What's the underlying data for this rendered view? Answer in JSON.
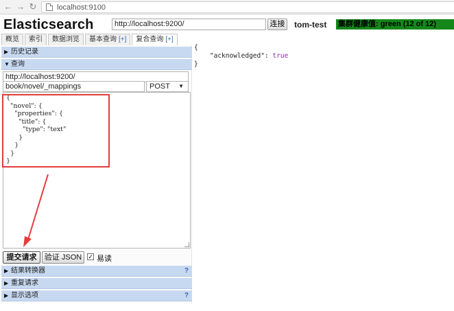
{
  "browser": {
    "url": "localhost:9100"
  },
  "header": {
    "title": "Elasticsearch",
    "connection_url": "http://localhost:9200/",
    "connect_label": "连接",
    "cluster_name": "tom-test",
    "health_text": "集群健康值: green (12 of 12)",
    "health_color": "#14871a"
  },
  "tabs": [
    {
      "label": "概览",
      "plus": ""
    },
    {
      "label": "索引",
      "plus": ""
    },
    {
      "label": "数据浏览",
      "plus": ""
    },
    {
      "label": "基本查询",
      "plus": "[+]"
    },
    {
      "label": "复合查询",
      "plus": "[+]",
      "active": true
    }
  ],
  "left_panel": {
    "history_label": "历史记录",
    "query_label": "查询",
    "server_url": "http://localhost:9200/",
    "path": "book/novel/_mappings",
    "method": "POST",
    "request_body_lines": [
      "{",
      "  \"novel\": {",
      "    \"properties\": {",
      "      \"title\": {",
      "        \"type\": \"text\"",
      "      }",
      "    }",
      "  }",
      "}"
    ],
    "submit_label": "提交请求",
    "validate_label": "验证 JSON",
    "pretty_label": "易读",
    "pretty_checked": true,
    "sections": [
      {
        "label": "结果转换器",
        "help": "?"
      },
      {
        "label": "重复请求",
        "help": ""
      },
      {
        "label": "显示选项",
        "help": "?"
      }
    ]
  },
  "result": {
    "open_brace": "{",
    "key": "\"acknowledged\"",
    "separator": ": ",
    "value": "true",
    "close_brace": "}"
  },
  "colors": {
    "section_bar": "#c7d9f1",
    "highlight": "#e53b3b",
    "bool_value": "#8a2ba8"
  }
}
